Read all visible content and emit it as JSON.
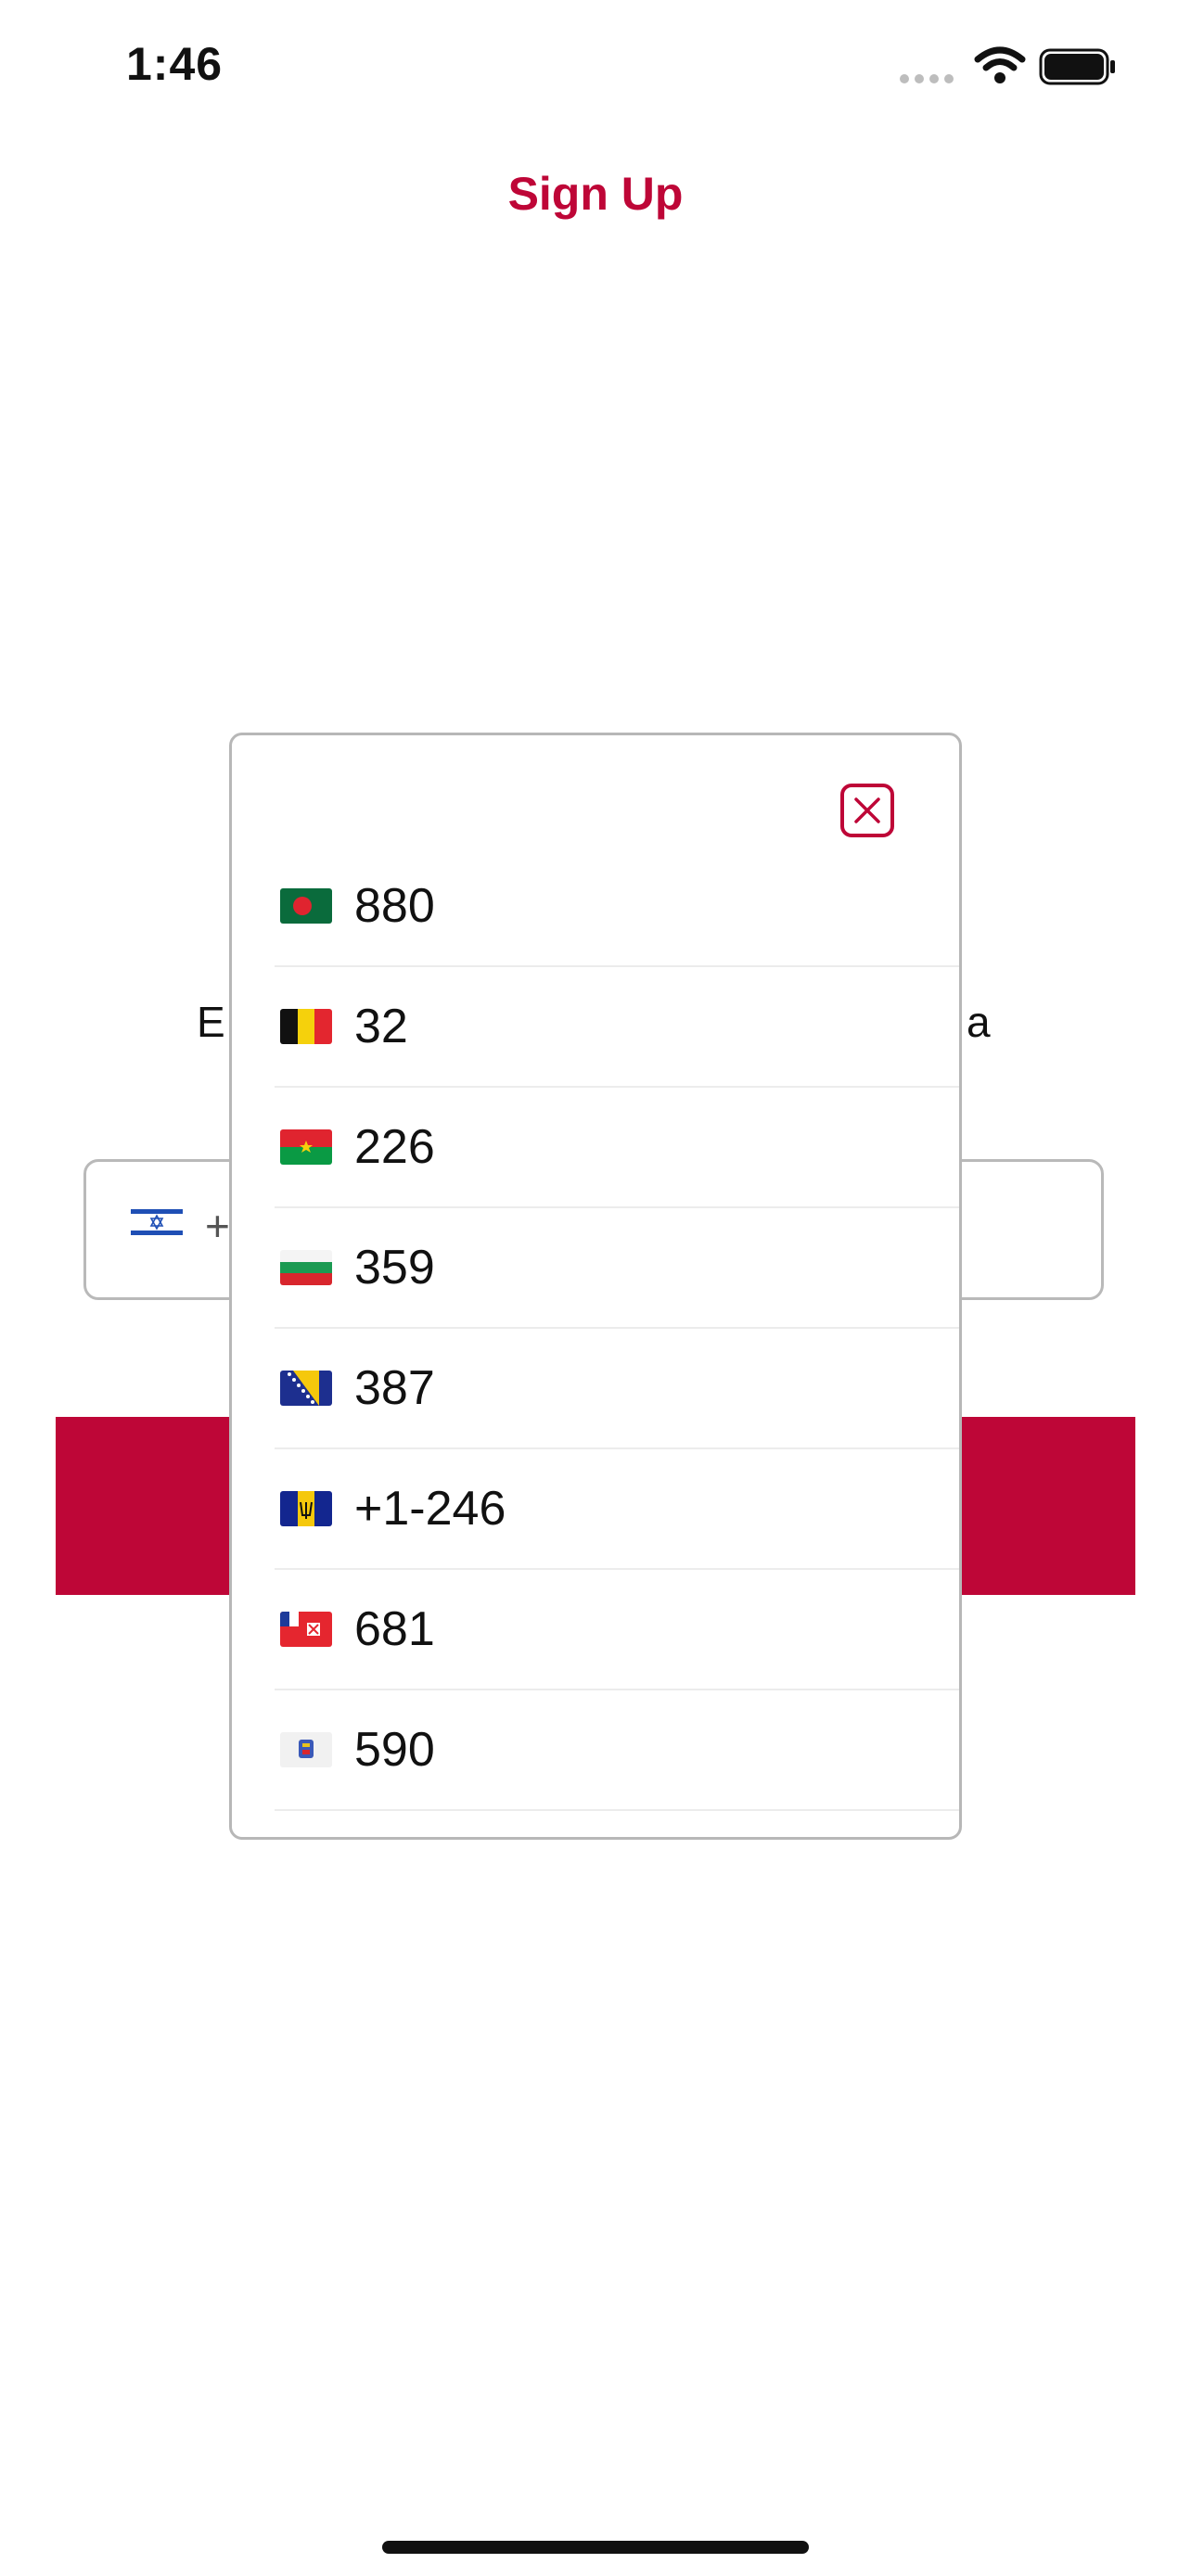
{
  "status_bar": {
    "time": "1:46"
  },
  "header": {
    "title": "Sign Up"
  },
  "background": {
    "text_left": "E",
    "text_right": "a",
    "phone_prefix": "+"
  },
  "modal": {
    "codes": [
      {
        "code": "880",
        "flag": "bangladesh-flag-icon"
      },
      {
        "code": "32",
        "flag": "belgium-flag-icon"
      },
      {
        "code": "226",
        "flag": "burkina-faso-flag-icon"
      },
      {
        "code": "359",
        "flag": "bulgaria-flag-icon"
      },
      {
        "code": "387",
        "flag": "bosnia-herzegovina-flag-icon"
      },
      {
        "code": "+1-246",
        "flag": "barbados-flag-icon"
      },
      {
        "code": "681",
        "flag": "wallis-futuna-flag-icon"
      },
      {
        "code": "590",
        "flag": "saint-barthelemy-flag-icon"
      }
    ]
  },
  "colors": {
    "accent": "#be0637"
  }
}
